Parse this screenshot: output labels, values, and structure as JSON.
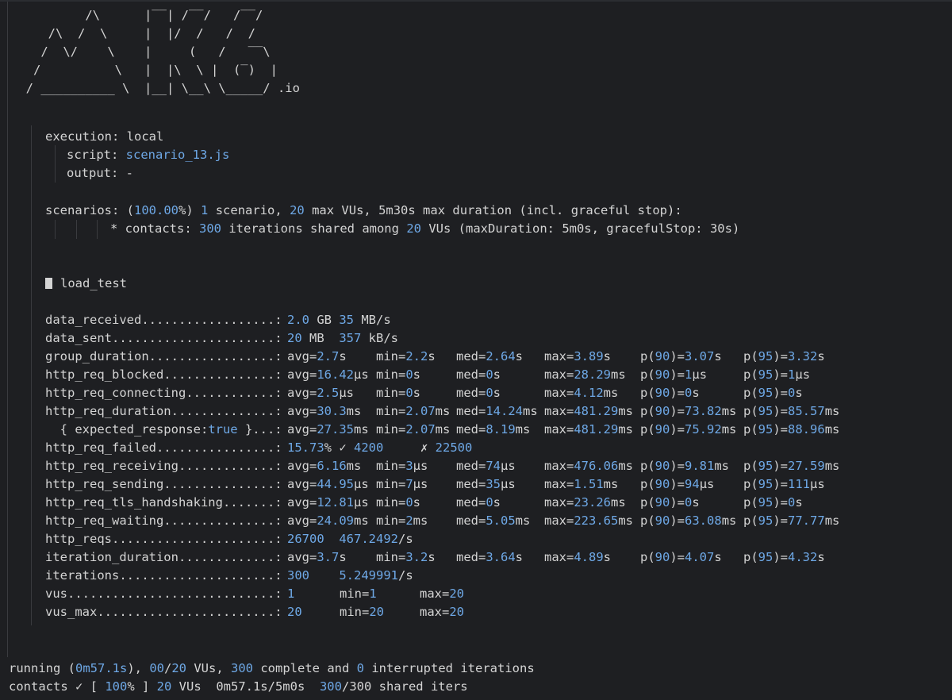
{
  "logo": {
    "ascii": "          /\\      |‾‾| /‾‾/   /‾‾/   \n     /\\  /  \\     |  |/  /   /  /    \n    /  \\/    \\    |     (   /   ‾‾\\  \n   /          \\   |  |\\  \\ |  (‾)  | \n  / __________ \\  |__| \\__\\ \\_____/ .io"
  },
  "execution": {
    "execution_label": "execution:",
    "execution_value": "local",
    "script_label": "script:",
    "script_value": "scenario_13.js",
    "output_label": "output:",
    "output_value": "-"
  },
  "scenarios": {
    "label": "scenarios:",
    "open": "(",
    "percent": "100.00",
    "pct_rest": "%)",
    "count": "1",
    "t1": "scenario,",
    "max_vus": "20",
    "t2": "max VUs, 5m30s max duration (incl. graceful stop):",
    "detail_prefix": "* contacts:",
    "iterations": "300",
    "t3": "iterations shared among",
    "vus": "20",
    "t4": "VUs (maxDuration: 5m0s, gracefulStop: 30s)"
  },
  "group": {
    "name": "load_test"
  },
  "metrics": [
    {
      "name": "data_received..................:",
      "cells": [
        {
          "n": "2.0",
          "t": " GB "
        },
        {
          "n": "35",
          "t": " MB/s"
        }
      ]
    },
    {
      "name": "data_sent......................:",
      "cells": [
        {
          "n": "20",
          "t": " MB  "
        },
        {
          "n": "357",
          "t": " kB/s"
        }
      ]
    },
    {
      "name": "group_duration.................:",
      "stats": [
        {
          "p": "avg=",
          "n": "2.7",
          "s": "s"
        },
        {
          "p": "min=",
          "n": "2.2",
          "s": "s"
        },
        {
          "p": "med=",
          "n": "2.64",
          "s": "s"
        },
        {
          "p": "max=",
          "n": "3.89",
          "s": "s"
        },
        {
          "p": "p(",
          "n": "90",
          "s": ")=",
          "n2": "3.07",
          "s2": "s"
        },
        {
          "p": "p(",
          "n": "95",
          "s": ")=",
          "n2": "3.32",
          "s2": "s"
        }
      ]
    },
    {
      "name": "http_req_blocked...............:",
      "stats": [
        {
          "p": "avg=",
          "n": "16.42",
          "s": "µs"
        },
        {
          "p": "min=",
          "n": "0",
          "s": "s"
        },
        {
          "p": "med=",
          "n": "0",
          "s": "s"
        },
        {
          "p": "max=",
          "n": "28.29",
          "s": "ms"
        },
        {
          "p": "p(",
          "n": "90",
          "s": ")=",
          "n2": "1",
          "s2": "µs"
        },
        {
          "p": "p(",
          "n": "95",
          "s": ")=",
          "n2": "1",
          "s2": "µs"
        }
      ]
    },
    {
      "name": "http_req_connecting............:",
      "stats": [
        {
          "p": "avg=",
          "n": "2.5",
          "s": "µs"
        },
        {
          "p": "min=",
          "n": "0",
          "s": "s"
        },
        {
          "p": "med=",
          "n": "0",
          "s": "s"
        },
        {
          "p": "max=",
          "n": "4.12",
          "s": "ms"
        },
        {
          "p": "p(",
          "n": "90",
          "s": ")=",
          "n2": "0",
          "s2": "s"
        },
        {
          "p": "p(",
          "n": "95",
          "s": ")=",
          "n2": "0",
          "s2": "s"
        }
      ]
    },
    {
      "name": "http_req_duration..............:",
      "stats": [
        {
          "p": "avg=",
          "n": "30.3",
          "s": "ms"
        },
        {
          "p": "min=",
          "n": "2.07",
          "s": "ms"
        },
        {
          "p": "med=",
          "n": "14.24",
          "s": "ms"
        },
        {
          "p": "max=",
          "n": "481.29",
          "s": "ms"
        },
        {
          "p": "p(",
          "n": "90",
          "s": ")=",
          "n2": "73.82",
          "s2": "ms"
        },
        {
          "p": "p(",
          "n": "95",
          "s": ")=",
          "n2": "85.57",
          "s2": "ms"
        }
      ]
    },
    {
      "name": "  { expected_response:",
      "name_kw": "true",
      "name_tail": " }...:",
      "stats": [
        {
          "p": "avg=",
          "n": "27.35",
          "s": "ms"
        },
        {
          "p": "min=",
          "n": "2.07",
          "s": "ms"
        },
        {
          "p": "med=",
          "n": "8.19",
          "s": "ms"
        },
        {
          "p": "max=",
          "n": "481.29",
          "s": "ms"
        },
        {
          "p": "p(",
          "n": "90",
          "s": ")=",
          "n2": "75.92",
          "s2": "ms"
        },
        {
          "p": "p(",
          "n": "95",
          "s": ")=",
          "n2": "88.96",
          "s2": "ms"
        }
      ]
    },
    {
      "name": "http_req_failed................:",
      "cells": [
        {
          "n": "15.73",
          "t": "% ✓ "
        },
        {
          "n": "4200",
          "t": "     ✗ "
        },
        {
          "n": "22500",
          "t": ""
        }
      ]
    },
    {
      "name": "http_req_receiving.............:",
      "stats": [
        {
          "p": "avg=",
          "n": "6.16",
          "s": "ms"
        },
        {
          "p": "min=",
          "n": "3",
          "s": "µs"
        },
        {
          "p": "med=",
          "n": "74",
          "s": "µs"
        },
        {
          "p": "max=",
          "n": "476.06",
          "s": "ms"
        },
        {
          "p": "p(",
          "n": "90",
          "s": ")=",
          "n2": "9.81",
          "s2": "ms"
        },
        {
          "p": "p(",
          "n": "95",
          "s": ")=",
          "n2": "27.59",
          "s2": "ms"
        }
      ]
    },
    {
      "name": "http_req_sending...............:",
      "stats": [
        {
          "p": "avg=",
          "n": "44.95",
          "s": "µs"
        },
        {
          "p": "min=",
          "n": "7",
          "s": "µs"
        },
        {
          "p": "med=",
          "n": "35",
          "s": "µs"
        },
        {
          "p": "max=",
          "n": "1.51",
          "s": "ms"
        },
        {
          "p": "p(",
          "n": "90",
          "s": ")=",
          "n2": "94",
          "s2": "µs"
        },
        {
          "p": "p(",
          "n": "95",
          "s": ")=",
          "n2": "111",
          "s2": "µs"
        }
      ]
    },
    {
      "name": "http_req_tls_handshaking.......:",
      "stats": [
        {
          "p": "avg=",
          "n": "12.81",
          "s": "µs"
        },
        {
          "p": "min=",
          "n": "0",
          "s": "s"
        },
        {
          "p": "med=",
          "n": "0",
          "s": "s"
        },
        {
          "p": "max=",
          "n": "23.26",
          "s": "ms"
        },
        {
          "p": "p(",
          "n": "90",
          "s": ")=",
          "n2": "0",
          "s2": "s"
        },
        {
          "p": "p(",
          "n": "95",
          "s": ")=",
          "n2": "0",
          "s2": "s"
        }
      ]
    },
    {
      "name": "http_req_waiting...............:",
      "stats": [
        {
          "p": "avg=",
          "n": "24.09",
          "s": "ms"
        },
        {
          "p": "min=",
          "n": "2",
          "s": "ms"
        },
        {
          "p": "med=",
          "n": "5.05",
          "s": "ms"
        },
        {
          "p": "max=",
          "n": "223.65",
          "s": "ms"
        },
        {
          "p": "p(",
          "n": "90",
          "s": ")=",
          "n2": "63.08",
          "s2": "ms"
        },
        {
          "p": "p(",
          "n": "95",
          "s": ")=",
          "n2": "77.77",
          "s2": "ms"
        }
      ]
    },
    {
      "name": "http_reqs......................:",
      "cells": [
        {
          "n": "26700",
          "t": "  "
        },
        {
          "n": "467.2492",
          "t": "/s"
        }
      ]
    },
    {
      "name": "iteration_duration.............:",
      "stats": [
        {
          "p": "avg=",
          "n": "3.7",
          "s": "s"
        },
        {
          "p": "min=",
          "n": "3.2",
          "s": "s"
        },
        {
          "p": "med=",
          "n": "3.64",
          "s": "s"
        },
        {
          "p": "max=",
          "n": "4.89",
          "s": "s"
        },
        {
          "p": "p(",
          "n": "90",
          "s": ")=",
          "n2": "4.07",
          "s2": "s"
        },
        {
          "p": "p(",
          "n": "95",
          "s": ")=",
          "n2": "4.32",
          "s2": "s"
        }
      ]
    },
    {
      "name": "iterations.....................:",
      "cells": [
        {
          "n": "300",
          "t": "    "
        },
        {
          "n": "5.249991",
          "t": "/s"
        }
      ]
    },
    {
      "name": "vus............................:",
      "triple": [
        {
          "n": "1",
          "t": ""
        },
        {
          "p": "min=",
          "n": "1"
        },
        {
          "p": "max=",
          "n": "20"
        }
      ]
    },
    {
      "name": "vus_max........................:",
      "triple": [
        {
          "n": "20",
          "t": ""
        },
        {
          "p": "min=",
          "n": "20"
        },
        {
          "p": "max=",
          "n": "20"
        }
      ]
    }
  ],
  "status": {
    "running_prefix": "running (",
    "running_time": "0m57.1s",
    "running_t1": "), ",
    "vus_cur": "00",
    "vus_sep": "/",
    "vus_max": "20",
    "running_t2": " VUs, ",
    "complete": "300",
    "running_t3": " complete and ",
    "interrupted": "0",
    "running_t4": " interrupted iterations",
    "progress_prefix": "contacts ✓ [ ",
    "progress_pct": "100",
    "progress_t1": "% ] ",
    "progress_vus": "20",
    "progress_t2": " VUs  0m57.1s/5m0s  ",
    "progress_done": "300",
    "progress_sep": "/",
    "progress_total": "300",
    "progress_t3": " shared iters"
  }
}
